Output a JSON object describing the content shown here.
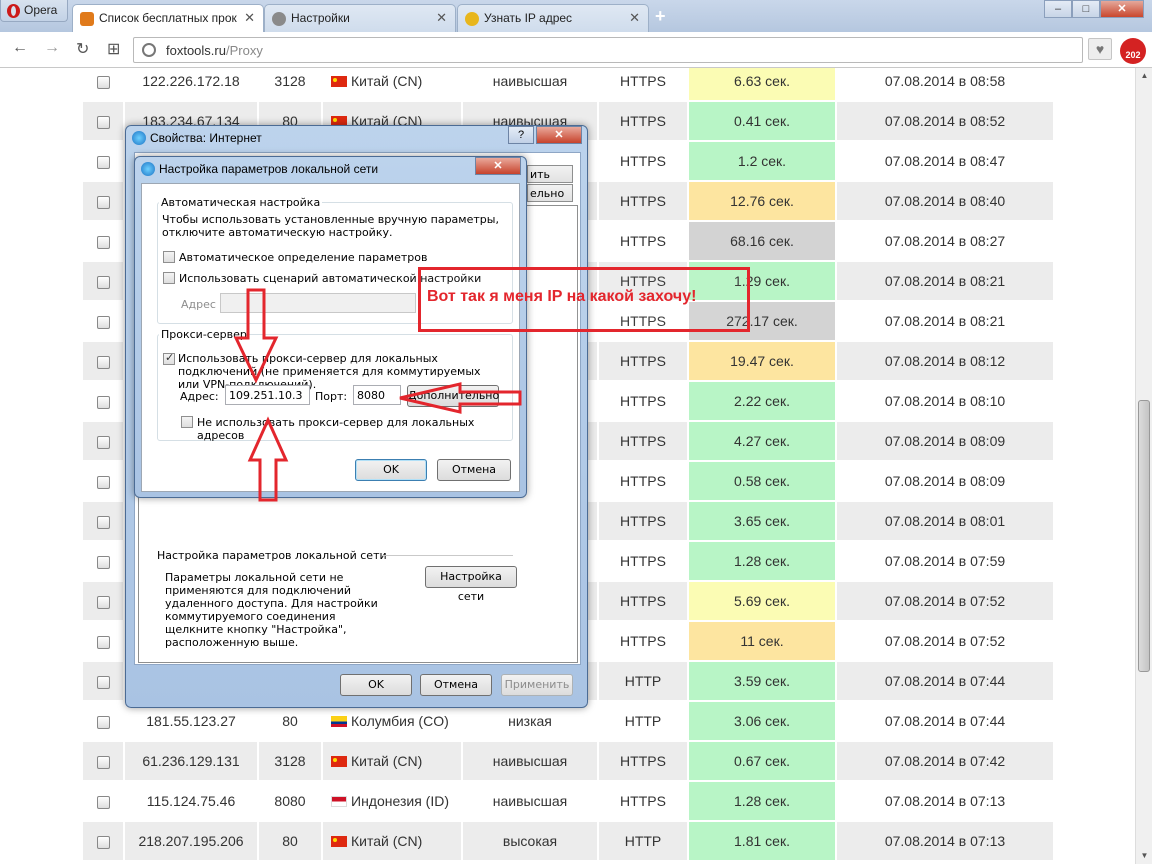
{
  "browser": {
    "menu_label": "Opera",
    "tabs": [
      {
        "label": "Список бесплатных прок",
        "close": "✕"
      },
      {
        "label": "Настройки",
        "close": "✕"
      },
      {
        "label": "Узнать IP адрес",
        "close": "✕"
      }
    ],
    "new_tab": "+",
    "window_buttons": {
      "minimize": "–",
      "maximize": "□",
      "close": "✕"
    },
    "url_domain": "foxtools.ru",
    "url_path": "/Proxy",
    "badge_count": "202",
    "back": "←",
    "forward": "→",
    "reload": "↻",
    "grid": "⊞",
    "heart": "♥"
  },
  "proxy_rows": [
    {
      "ip": "122.226.172.18",
      "port": "3128",
      "flag": "CN",
      "country": "Китай (CN)",
      "anon": "наивысшая",
      "type": "HTTPS",
      "speed": "6.63 сек.",
      "speed_color": "yellow",
      "date": "07.08.2014 в 08:58"
    },
    {
      "ip": "183.234.67.134",
      "port": "80",
      "flag": "CN",
      "country": "Китай (CN)",
      "anon": "наивысшая",
      "type": "HTTPS",
      "speed": "0.41 сек.",
      "speed_color": "green",
      "date": "07.08.2014 в 08:52"
    },
    {
      "ip": "",
      "port": "",
      "flag": "",
      "country": "",
      "anon": "",
      "type": "HTTPS",
      "speed": "1.2 сек.",
      "speed_color": "green",
      "date": "07.08.2014 в 08:47"
    },
    {
      "ip": "",
      "port": "",
      "flag": "",
      "country": "",
      "anon": "",
      "type": "HTTPS",
      "speed": "12.76 сек.",
      "speed_color": "orange",
      "date": "07.08.2014 в 08:40"
    },
    {
      "ip": "",
      "port": "",
      "flag": "",
      "country": "",
      "anon": "",
      "type": "HTTPS",
      "speed": "68.16 сек.",
      "speed_color": "gray",
      "date": "07.08.2014 в 08:27"
    },
    {
      "ip": "",
      "port": "",
      "flag": "",
      "country": "",
      "anon": "",
      "type": "HTTPS",
      "speed": "1.29 сек.",
      "speed_color": "green",
      "date": "07.08.2014 в 08:21"
    },
    {
      "ip": "",
      "port": "",
      "flag": "",
      "country": "",
      "anon": "",
      "type": "HTTPS",
      "speed": "272.17 сек.",
      "speed_color": "gray",
      "date": "07.08.2014 в 08:21"
    },
    {
      "ip": "",
      "port": "",
      "flag": "",
      "country": "",
      "anon": "",
      "type": "HTTPS",
      "speed": "19.47 сек.",
      "speed_color": "orange",
      "date": "07.08.2014 в 08:12"
    },
    {
      "ip": "",
      "port": "",
      "flag": "",
      "country": "",
      "anon": "",
      "type": "HTTPS",
      "speed": "2.22 сек.",
      "speed_color": "green",
      "date": "07.08.2014 в 08:10"
    },
    {
      "ip": "",
      "port": "",
      "flag": "",
      "country": "",
      "anon": "",
      "type": "HTTPS",
      "speed": "4.27 сек.",
      "speed_color": "green",
      "date": "07.08.2014 в 08:09"
    },
    {
      "ip": "",
      "port": "",
      "flag": "",
      "country": "",
      "anon": "",
      "type": "HTTPS",
      "speed": "0.58 сек.",
      "speed_color": "green",
      "date": "07.08.2014 в 08:09"
    },
    {
      "ip": "",
      "port": "",
      "flag": "",
      "country": "",
      "anon": "",
      "type": "HTTPS",
      "speed": "3.65 сек.",
      "speed_color": "green",
      "date": "07.08.2014 в 08:01"
    },
    {
      "ip": "",
      "port": "",
      "flag": "",
      "country": "",
      "anon": "",
      "type": "HTTPS",
      "speed": "1.28 сек.",
      "speed_color": "green",
      "date": "07.08.2014 в 07:59"
    },
    {
      "ip": "",
      "port": "",
      "flag": "",
      "country": "",
      "anon": "",
      "type": "HTTPS",
      "speed": "5.69 сек.",
      "speed_color": "yellow",
      "date": "07.08.2014 в 07:52"
    },
    {
      "ip": "",
      "port": "",
      "flag": "",
      "country": "",
      "anon": "",
      "type": "HTTPS",
      "speed": "11 сек.",
      "speed_color": "orange",
      "date": "07.08.2014 в 07:52"
    },
    {
      "ip": "",
      "port": "",
      "flag": "",
      "country": "",
      "anon": "",
      "type": "HTTP",
      "speed": "3.59 сек.",
      "speed_color": "green",
      "date": "07.08.2014 в 07:44"
    },
    {
      "ip": "181.55.123.27",
      "port": "80",
      "flag": "CO",
      "country": "Колумбия (CO)",
      "anon": "низкая",
      "type": "HTTP",
      "speed": "3.06 сек.",
      "speed_color": "green",
      "date": "07.08.2014 в 07:44"
    },
    {
      "ip": "61.236.129.131",
      "port": "3128",
      "flag": "CN",
      "country": "Китай (CN)",
      "anon": "наивысшая",
      "type": "HTTPS",
      "speed": "0.67 сек.",
      "speed_color": "green",
      "date": "07.08.2014 в 07:42"
    },
    {
      "ip": "115.124.75.46",
      "port": "8080",
      "flag": "ID",
      "country": "Индонезия (ID)",
      "anon": "наивысшая",
      "type": "HTTPS",
      "speed": "1.28 сек.",
      "speed_color": "green",
      "date": "07.08.2014 в 07:13"
    },
    {
      "ip": "218.207.195.206",
      "port": "80",
      "flag": "CN",
      "country": "Китай (CN)",
      "anon": "высокая",
      "type": "HTTP",
      "speed": "1.81 сек.",
      "speed_color": "green",
      "date": "07.08.2014 в 07:13"
    }
  ],
  "inet_dialog": {
    "title": "Свойства: Интернет",
    "help": "?",
    "close": "✕",
    "tab_fragment_1": "ить",
    "tab_fragment_2": "ельно",
    "lan_section_title": "Настройка параметров локальной сети",
    "lan_desc": "Параметры локальной сети не применяются для подключений удаленного доступа. Для настройки коммутируемого соединения щелкните кнопку \"Настройка\", расположенную выше.",
    "lan_button": "Настройка сети",
    "ok": "OK",
    "cancel": "Отмена",
    "apply": "Применить"
  },
  "lan_dialog": {
    "title": "Настройка параметров локальной сети",
    "close": "✕",
    "auto_group": "Автоматическая настройка",
    "auto_desc": "Чтобы использовать установленные вручную параметры, отключите автоматическую настройку.",
    "auto_detect": "Автоматическое определение параметров",
    "auto_script": "Использовать сценарий автоматической настройки",
    "address_label": "Адрес",
    "proxy_group": "Прокси-сервер",
    "use_proxy": "Использовать прокси-сервер для локальных подключений (не применяется для коммутируемых или VPN-подключений).",
    "proxy_address_label": "Адрес:",
    "proxy_address": "109.251.10.3",
    "port_label": "Порт:",
    "port": "8080",
    "advanced": "Дополнительно",
    "bypass_local": "Не использовать прокси-сервер для локальных адресов",
    "ok": "OK",
    "cancel": "Отмена"
  },
  "annotation": {
    "text": "Вот так я меня IP на какой захочу!",
    "color": "#e3262d"
  },
  "colors": {
    "green": "#b8f5c6",
    "yellow": "#fbfcb4",
    "orange": "#fde5a0",
    "gray": "#d3d3d3"
  }
}
